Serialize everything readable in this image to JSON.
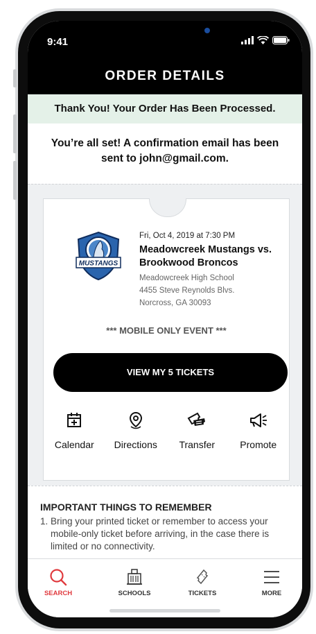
{
  "status_bar": {
    "time": "9:41"
  },
  "header": {
    "title": "ORDER DETAILS"
  },
  "banner": {
    "text": "Thank You! Your Order Has Been Processed."
  },
  "confirmation": {
    "text": "You’re all set! A confirmation email has been sent to john@gmail.com."
  },
  "event": {
    "datetime": "Fri, Oct 4, 2019 at 7:30 PM",
    "title": "Meadowcreek Mustangs vs. Brookwood Broncos",
    "venue": "Meadowcreek High School",
    "address1": "4455 Steve Reynolds Blvs.",
    "address2": "Norcross, GA 30093",
    "logo_text": "MUSTANGS",
    "note": "*** MOBILE ONLY EVENT ***"
  },
  "view_button": {
    "label": "VIEW MY 5 TICKETS"
  },
  "actions": [
    {
      "label": "Calendar",
      "icon": "calendar-plus-icon"
    },
    {
      "label": "Directions",
      "icon": "map-pin-icon"
    },
    {
      "label": "Transfer",
      "icon": "ticket-transfer-icon"
    },
    {
      "label": "Promote",
      "icon": "megaphone-icon"
    }
  ],
  "important": {
    "title": "IMPORTANT THINGS TO REMEMBER",
    "items": [
      "1. Bring your printed ticket or remember to access your mobile-only ticket before arriving, in the case there is limited or no connectivity."
    ]
  },
  "tabs": [
    {
      "label": "SEARCH",
      "icon": "search-icon",
      "active": true
    },
    {
      "label": "SCHOOLS",
      "icon": "school-icon",
      "active": false
    },
    {
      "label": "TICKETS",
      "icon": "ticket-icon",
      "active": false
    },
    {
      "label": "MORE",
      "icon": "menu-icon",
      "active": false
    }
  ],
  "colors": {
    "accent": "#e03a3e",
    "banner_bg": "#e4f1e8",
    "dark": "#000000"
  }
}
